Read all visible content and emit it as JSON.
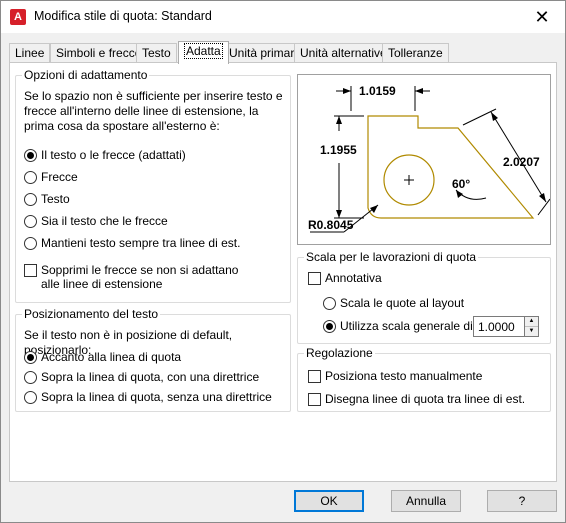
{
  "window": {
    "title": "Modifica stile di quota: Standard",
    "app_icon_letter": "A"
  },
  "tabs": [
    {
      "label": "Linee"
    },
    {
      "label": "Simboli e frecce"
    },
    {
      "label": "Testo"
    },
    {
      "label": "Adatta",
      "active": true
    },
    {
      "label": "Unità primarie"
    },
    {
      "label": "Unità alternative"
    },
    {
      "label": "Tolleranze"
    }
  ],
  "fit_options": {
    "title": "Opzioni di adattamento",
    "description": "Se lo spazio non è sufficiente per inserire testo e frecce all'interno delle linee di estensione, la prima cosa da spostare all'esterno è:",
    "options": [
      {
        "label": "Il testo o le frecce (adattati)",
        "checked": true
      },
      {
        "label": "Frecce",
        "checked": false
      },
      {
        "label": "Testo",
        "checked": false
      },
      {
        "label": "Sia il testo che le frecce",
        "checked": false
      },
      {
        "label": "Mantieni testo sempre tra linee di est.",
        "checked": false
      }
    ],
    "suppress_label_line1": "Sopprimi le frecce se non si adattano",
    "suppress_label_line2": "alle linee di estensione"
  },
  "text_placement": {
    "title": "Posizionamento del testo",
    "description": "Se il testo non è in posizione di default, posizionarlo:",
    "options": [
      {
        "label": "Accanto alla linea di quota",
        "checked": true
      },
      {
        "label": "Sopra la linea di quota, con una direttrice",
        "checked": false
      },
      {
        "label": "Sopra la linea di quota, senza una direttrice",
        "checked": false
      }
    ]
  },
  "preview": {
    "dim_top": "1.0159",
    "dim_left": "1.1955",
    "dim_right": "2.0207",
    "dim_angle": "60°",
    "dim_radius": "R0.8045",
    "shape_color": "#b08a00"
  },
  "scale": {
    "title": "Scala per le lavorazioni di quota",
    "annotative_label": "Annotativa",
    "layout_label": "Scala le quote al layout",
    "overall_label": "Utilizza scala generale di:",
    "overall_value": "1.0000"
  },
  "fine_tuning": {
    "title": "Regolazione",
    "manual_label": "Posiziona testo manualmente",
    "draw_label": "Disegna linee di quota tra linee di est."
  },
  "buttons": {
    "ok": "OK",
    "cancel": "Annulla",
    "help": "?"
  },
  "colors": {
    "accent": "#0078d7",
    "app_icon": "#d6202a"
  }
}
